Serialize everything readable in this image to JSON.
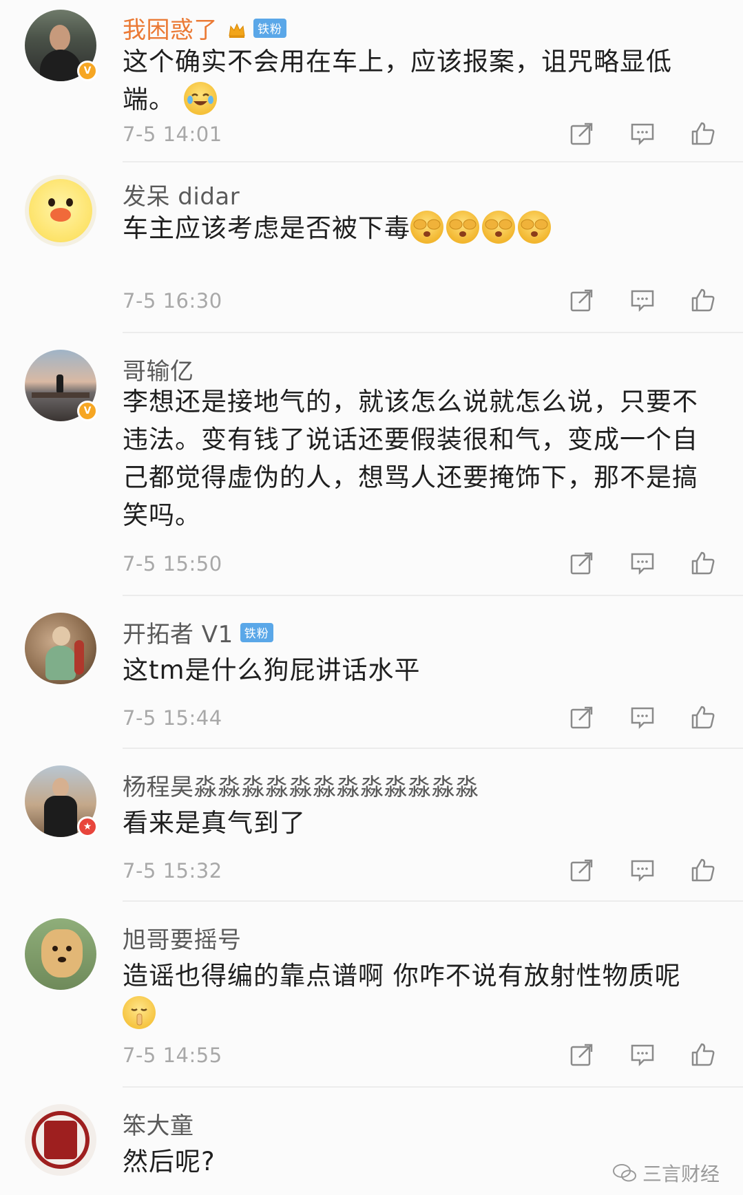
{
  "comments": [
    {
      "name": "我困惑了",
      "tag": "铁粉",
      "text": "这个确实不会用在车上，应该报案，诅咒略显低端。",
      "time": "7-5 14:01"
    },
    {
      "name": "发呆 didar",
      "text": "车主应该考虑是否被下毒",
      "time": "7-5 16:30"
    },
    {
      "name": "哥输亿",
      "text": "李想还是接地气的，就该怎么说就怎么说，只要不违法。变有钱了说话还要假装很和气，变成一个自己都觉得虚伪的人，想骂人还要掩饰下，那不是搞笑吗。",
      "time": "7-5 15:50"
    },
    {
      "name": "开拓者 V1",
      "tag": "铁粉",
      "text": "这tm是什么狗屁讲话水平",
      "time": "7-5 15:44"
    },
    {
      "name": "杨程昊淼淼淼淼淼淼淼淼淼淼淼淼",
      "text": "看来是真气到了",
      "time": "7-5 15:32"
    },
    {
      "name": "旭哥要摇号",
      "text": "造谣也得编的靠点谱啊 你咋不说有放射性物质呢",
      "time": "7-5 14:55"
    },
    {
      "name": "笨大童",
      "text": "然后呢?"
    }
  ],
  "icons": {
    "share": "share-icon",
    "comment": "comment-icon",
    "like": "thumbs-up-icon",
    "verified": "verified-badge-icon",
    "crown": "crown-icon"
  },
  "colors": {
    "vip_name": "#eb7a35",
    "fan_tag": "#5aa7e8",
    "verified_gold": "#f6a623",
    "verified_red": "#e8453c"
  },
  "watermark": "三言财经"
}
